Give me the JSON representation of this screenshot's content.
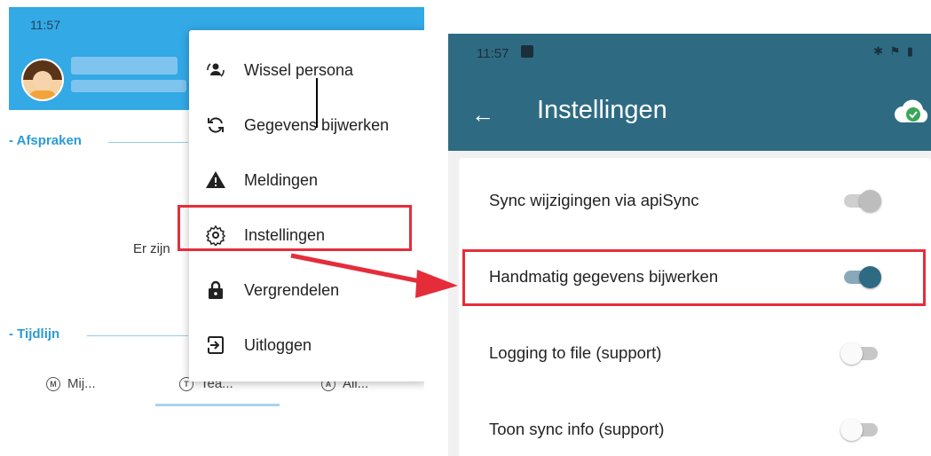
{
  "left": {
    "status_time": "11:57",
    "sections": {
      "afspraken": "- Afspraken",
      "tijdlijn": "- Tijdlijn"
    },
    "partial_text": "Er zijn",
    "tabs": [
      {
        "icon": "M",
        "label": "Mij..."
      },
      {
        "icon": "T",
        "label": "Tea..."
      },
      {
        "icon": "A",
        "label": "All..."
      }
    ],
    "menu": {
      "items": [
        {
          "label": "Wissel persona",
          "icon": "person-switch-icon"
        },
        {
          "label": "Gegevens bijwerken",
          "icon": "sync-icon"
        },
        {
          "label": "Meldingen",
          "icon": "warning-icon"
        },
        {
          "label": "Instellingen",
          "icon": "gear-icon"
        },
        {
          "label": "Vergrendelen",
          "icon": "lock-icon"
        },
        {
          "label": "Uitloggen",
          "icon": "logout-icon"
        }
      ]
    }
  },
  "right": {
    "status_time": "11:57",
    "title": "Instellingen",
    "settings": [
      {
        "label": "Sync wijzigingen via apiSync",
        "state": "on-disabled"
      },
      {
        "label": "Handmatig gegevens bijwerken",
        "state": "on"
      },
      {
        "label": "Logging to file (support)",
        "state": "off"
      },
      {
        "label": "Toon sync info (support)",
        "state": "off"
      }
    ]
  },
  "colors": {
    "left_header": "#33a9e6",
    "appbar": "#2e6b83",
    "highlight": "#e52d3a",
    "switch_on": "#2e6b83",
    "cloud": "#3aa657"
  }
}
